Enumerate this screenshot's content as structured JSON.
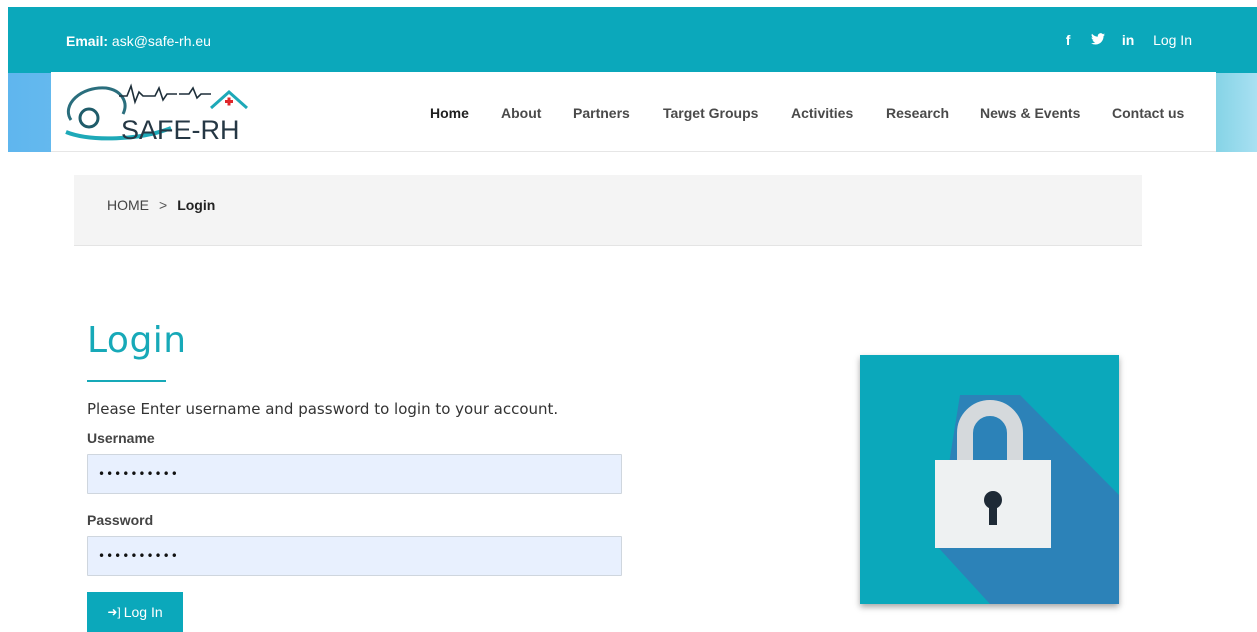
{
  "header": {
    "email_label": "Email:",
    "email_value": "ask@safe-rh.eu",
    "social": [
      {
        "icon": "facebook-icon",
        "glyph": "f"
      },
      {
        "icon": "twitter-icon",
        "glyph": "🐦"
      },
      {
        "icon": "linkedin-icon",
        "glyph": "in"
      }
    ],
    "login_link": "Log In",
    "accent_color": "#0ba8bb"
  },
  "logo": {
    "text": "SAFE-RH"
  },
  "nav": {
    "items": [
      "Home",
      "About",
      "Partners",
      "Target Groups",
      "Activities",
      "Research",
      "News & Events",
      "Contact us"
    ],
    "active": "Home"
  },
  "breadcrumb": {
    "home": "HOME",
    "separator": ">",
    "current": "Login"
  },
  "login": {
    "title": "Login",
    "intro": "Please Enter username and password to login to your account.",
    "username_label": "Username",
    "username_value": "••••••••••",
    "password_label": "Password",
    "password_value": "••••••••••",
    "button_label": "Log In",
    "button_icon": "sign-in-icon"
  },
  "illustration": {
    "icon": "padlock-icon"
  }
}
